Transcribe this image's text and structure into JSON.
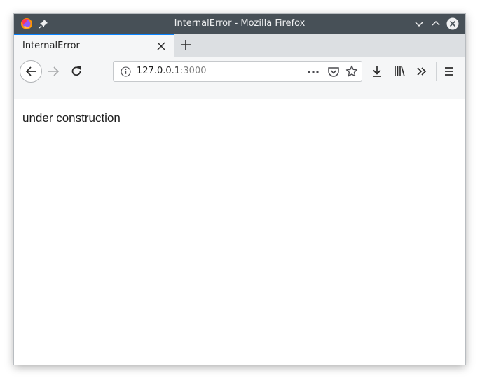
{
  "window": {
    "title": "InternalError - Mozilla Firefox",
    "controls": [
      "minimize-icon",
      "maximize-icon",
      "close-icon"
    ]
  },
  "tabs": [
    {
      "label": "InternalError",
      "active": true
    }
  ],
  "navbar": {
    "url_host": "127.0.0.1",
    "url_port": ":3000",
    "icons": [
      "back-icon",
      "forward-icon",
      "reload-icon",
      "info-icon",
      "more-icon",
      "pocket-icon",
      "star-icon",
      "download-icon",
      "library-icon",
      "overflow-icon",
      "menu-icon"
    ]
  },
  "content": {
    "text": "under construction"
  },
  "colors": {
    "titlebar": "#475057",
    "tab_accent": "#0a84ff",
    "toolbar": "#f5f6f7"
  }
}
